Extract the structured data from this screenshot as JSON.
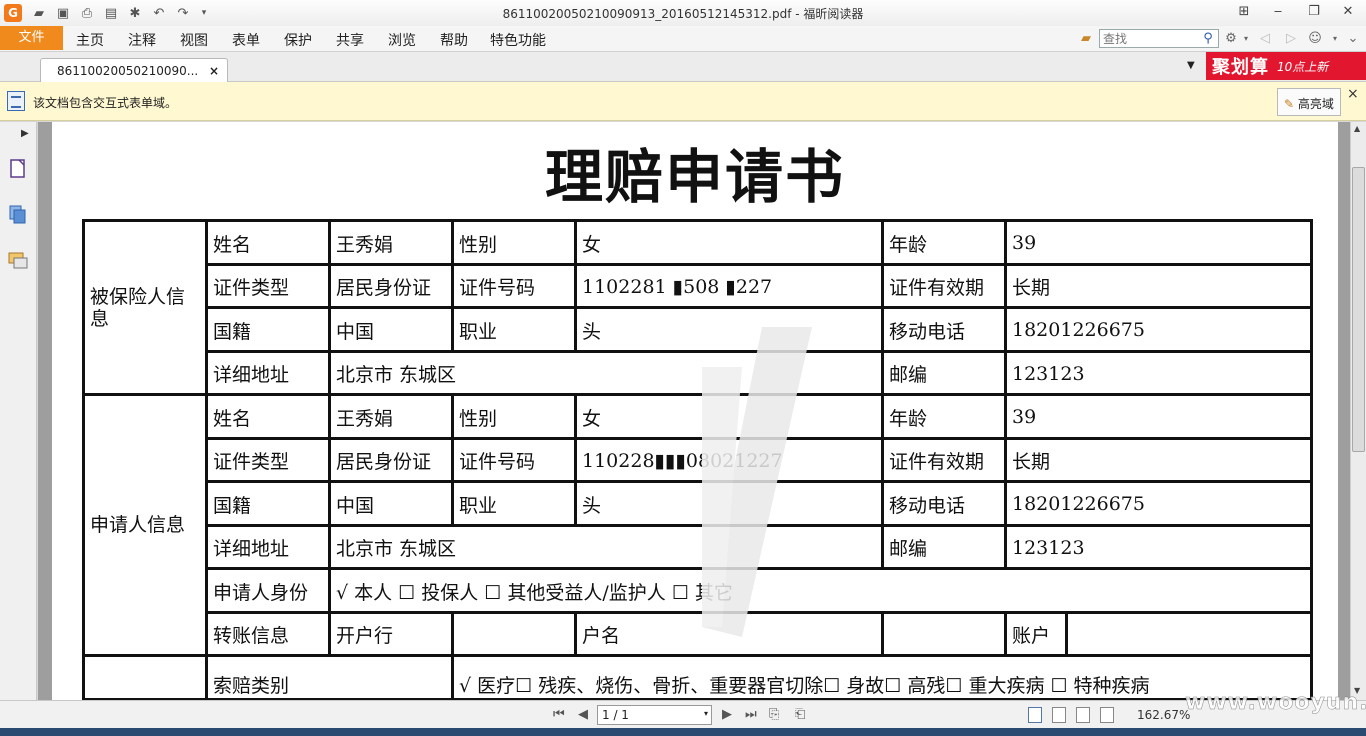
{
  "window": {
    "title": "86110020050210090913_20160512145312.pdf - 福昕阅读器",
    "logo_text": "G"
  },
  "menu": {
    "file_label": "文件",
    "items": [
      "主页",
      "注释",
      "视图",
      "表单",
      "保护",
      "共享",
      "浏览",
      "帮助",
      "特色功能"
    ],
    "search_placeholder": "查找"
  },
  "tab": {
    "label": "86110020050210090...",
    "close_label": "×"
  },
  "ad": {
    "main": "聚划算",
    "sub": "10点上新"
  },
  "notice": {
    "text": "该文档包含交互式表单域。",
    "highlight_button": "高亮域",
    "close_label": "×"
  },
  "document": {
    "title": "理赔申请书",
    "insured": {
      "group_label": "被保险人信息",
      "name_label": "姓名",
      "name": "王秀娟",
      "gender_label": "性别",
      "gender": "女",
      "age_label": "年龄",
      "age": "39",
      "id_type_label": "证件类型",
      "id_type": "居民身份证",
      "id_no_label": "证件号码",
      "id_no": "1102281 ▮508 ▮227",
      "validity_label": "证件有效期",
      "validity": "长期",
      "nationality_label": "国籍",
      "nationality": "中国",
      "occupation_label": "职业",
      "occupation": "头",
      "mobile_label": "移动电话",
      "mobile": "18201226675",
      "address_label": "详细地址",
      "address": "北京市 东城区",
      "postcode_label": "邮编",
      "postcode": "123123"
    },
    "applicant": {
      "group_label": "申请人信息",
      "name_label": "姓名",
      "name": "王秀娟",
      "gender_label": "性别",
      "gender": "女",
      "age_label": "年龄",
      "age": "39",
      "id_type_label": "证件类型",
      "id_type": "居民身份证",
      "id_no_label": "证件号码",
      "id_no": "110228▮▮▮08021227",
      "validity_label": "证件有效期",
      "validity": "长期",
      "nationality_label": "国籍",
      "nationality": "中国",
      "occupation_label": "职业",
      "occupation": "头",
      "mobile_label": "移动电话",
      "mobile": "18201226675",
      "address_label": "详细地址",
      "address": "北京市 东城区",
      "postcode_label": "邮编",
      "postcode": "123123",
      "identity_label": "申请人身份",
      "identity_options": "√  本人          ☐  投保人          ☐  其他受益人/监护人          ☐  其它",
      "transfer_label": "转账信息",
      "bank_label": "开户行",
      "account_name_label": "户名",
      "account_label": "账户"
    },
    "claim": {
      "type_label": "索赔类别",
      "type_options": "√  医疗☐  残疾、烧伤、骨折、重要器官切除☐  身故☐  高残☐  重大疾病  ☐  特种疾病"
    }
  },
  "status": {
    "page_indicator": "1 / 1",
    "zoom": "162.67%"
  },
  "site_watermark": "www.wooyun.org"
}
